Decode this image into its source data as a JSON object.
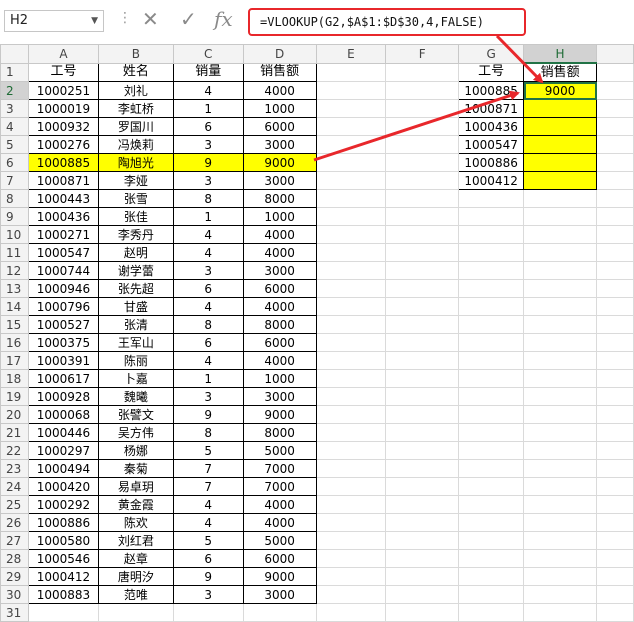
{
  "formula_bar": {
    "name_box": "H2",
    "dots": "⋮",
    "cancel_icon": "✕",
    "enter_icon": "✓",
    "fx_label": "fx",
    "formula": "=VLOOKUP(G2,$A$1:$D$30,4,FALSE)"
  },
  "columns": [
    "",
    "A",
    "B",
    "C",
    "D",
    "E",
    "F",
    "G",
    "H",
    ""
  ],
  "selected_column": "H",
  "selected_row": 2,
  "rows": [
    {
      "n": "1",
      "A": "工号",
      "B": "姓名",
      "C": "销量",
      "D": "销售额",
      "G": "工号",
      "H": "销售额"
    },
    {
      "n": "2",
      "A": "1000251",
      "B": "刘礼",
      "C": "4",
      "D": "4000",
      "G": "1000885",
      "H": "9000"
    },
    {
      "n": "3",
      "A": "1000019",
      "B": "李虹桥",
      "C": "1",
      "D": "1000",
      "G": "1000871",
      "H": ""
    },
    {
      "n": "4",
      "A": "1000932",
      "B": "罗国川",
      "C": "6",
      "D": "6000",
      "G": "1000436",
      "H": ""
    },
    {
      "n": "5",
      "A": "1000276",
      "B": "冯焕莉",
      "C": "3",
      "D": "3000",
      "G": "1000547",
      "H": ""
    },
    {
      "n": "6",
      "A": "1000885",
      "B": "陶旭光",
      "C": "9",
      "D": "9000",
      "G": "1000886",
      "H": ""
    },
    {
      "n": "7",
      "A": "1000871",
      "B": "李娅",
      "C": "3",
      "D": "3000",
      "G": "1000412",
      "H": ""
    },
    {
      "n": "8",
      "A": "1000443",
      "B": "张雪",
      "C": "8",
      "D": "8000"
    },
    {
      "n": "9",
      "A": "1000436",
      "B": "张佳",
      "C": "1",
      "D": "1000"
    },
    {
      "n": "10",
      "A": "1000271",
      "B": "李秀丹",
      "C": "4",
      "D": "4000"
    },
    {
      "n": "11",
      "A": "1000547",
      "B": "赵明",
      "C": "4",
      "D": "4000"
    },
    {
      "n": "12",
      "A": "1000744",
      "B": "谢学蕾",
      "C": "3",
      "D": "3000"
    },
    {
      "n": "13",
      "A": "1000946",
      "B": "张先超",
      "C": "6",
      "D": "6000"
    },
    {
      "n": "14",
      "A": "1000796",
      "B": "甘盛",
      "C": "4",
      "D": "4000"
    },
    {
      "n": "15",
      "A": "1000527",
      "B": "张清",
      "C": "8",
      "D": "8000"
    },
    {
      "n": "16",
      "A": "1000375",
      "B": "王军山",
      "C": "6",
      "D": "6000"
    },
    {
      "n": "17",
      "A": "1000391",
      "B": "陈丽",
      "C": "4",
      "D": "4000"
    },
    {
      "n": "18",
      "A": "1000617",
      "B": "卜嘉",
      "C": "1",
      "D": "1000"
    },
    {
      "n": "19",
      "A": "1000928",
      "B": "魏曦",
      "C": "3",
      "D": "3000"
    },
    {
      "n": "20",
      "A": "1000068",
      "B": "张譬文",
      "C": "9",
      "D": "9000"
    },
    {
      "n": "21",
      "A": "1000446",
      "B": "吴方伟",
      "C": "8",
      "D": "8000"
    },
    {
      "n": "22",
      "A": "1000297",
      "B": "杨娜",
      "C": "5",
      "D": "5000"
    },
    {
      "n": "23",
      "A": "1000494",
      "B": "秦菊",
      "C": "7",
      "D": "7000"
    },
    {
      "n": "24",
      "A": "1000420",
      "B": "易卓玥",
      "C": "7",
      "D": "7000"
    },
    {
      "n": "25",
      "A": "1000292",
      "B": "黄金霞",
      "C": "4",
      "D": "4000"
    },
    {
      "n": "26",
      "A": "1000886",
      "B": "陈欢",
      "C": "4",
      "D": "4000"
    },
    {
      "n": "27",
      "A": "1000580",
      "B": "刘红君",
      "C": "5",
      "D": "5000"
    },
    {
      "n": "28",
      "A": "1000546",
      "B": "赵章",
      "C": "6",
      "D": "6000"
    },
    {
      "n": "29",
      "A": "1000412",
      "B": "唐明汐",
      "C": "9",
      "D": "9000"
    },
    {
      "n": "30",
      "A": "1000883",
      "B": "范唯",
      "C": "3",
      "D": "3000"
    },
    {
      "n": "31"
    }
  ],
  "colors": {
    "highlight": "#ffff00",
    "annotation": "#e8272b",
    "selection": "#217346"
  }
}
